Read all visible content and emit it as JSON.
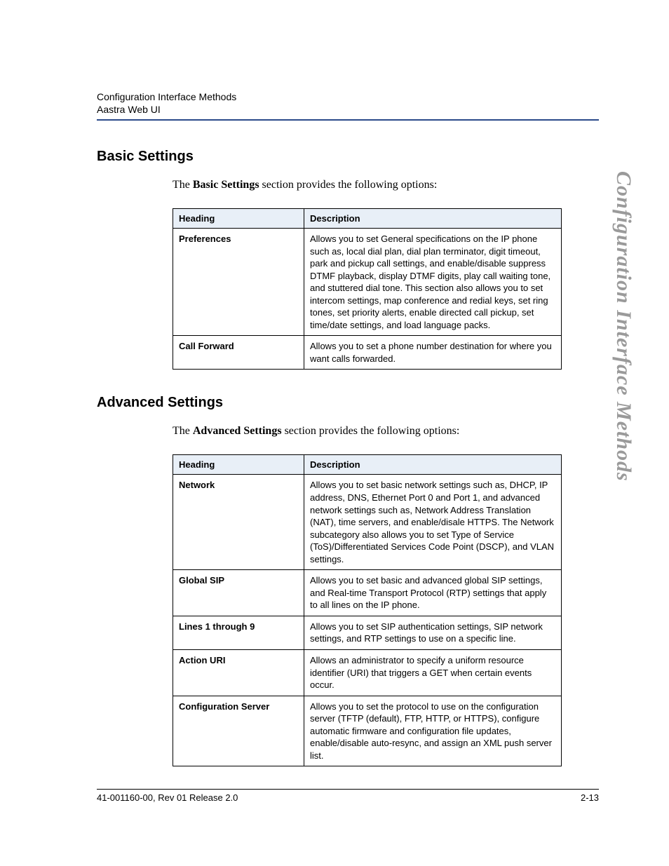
{
  "header": {
    "line1": "Configuration Interface Methods",
    "line2": "Aastra Web UI"
  },
  "side_title": "Configuration Interface Methods",
  "sections": {
    "basic": {
      "heading": "Basic Settings",
      "intro_prefix": "The ",
      "intro_bold": "Basic Settings",
      "intro_suffix": " section provides the following options:",
      "col_heading": "Heading",
      "col_description": "Description",
      "rows": [
        {
          "heading": "Preferences",
          "description": "Allows you to set General specifications on the IP phone such as, local dial plan, dial plan terminator, digit timeout, park and pickup call settings, and enable/disable suppress DTMF playback, display DTMF digits, play call waiting tone, and stuttered dial tone. This section also allows you to set intercom settings, map conference and redial keys, set ring tones, set priority alerts, enable directed call pickup, set time/date settings, and load language packs."
        },
        {
          "heading": "Call Forward",
          "description": "Allows you to set a phone number destination for where you want calls forwarded."
        }
      ]
    },
    "advanced": {
      "heading": "Advanced Settings",
      "intro_prefix": "The ",
      "intro_bold": "Advanced Settings",
      "intro_suffix": " section provides the following options:",
      "col_heading": "Heading",
      "col_description": "Description",
      "rows": [
        {
          "heading": "Network",
          "description": "Allows you to set basic network settings such as, DHCP, IP address, DNS, Ethernet Port 0 and Port 1, and advanced network settings such as, Network Address Translation (NAT), time servers, and enable/disale HTTPS. The Network subcategory also allows you to set Type of Service (ToS)/Differentiated Services Code Point (DSCP), and VLAN settings."
        },
        {
          "heading": "Global SIP",
          "description": "Allows you to set basic and advanced global SIP settings, and Real-time Transport Protocol (RTP) settings that apply to all lines on the IP phone."
        },
        {
          "heading": "Lines 1 through 9",
          "description": "Allows you to set SIP authentication settings, SIP network settings, and RTP settings to use on a specific line."
        },
        {
          "heading": "Action URI",
          "description": "Allows an administrator to specify a uniform resource identifier (URI) that triggers a GET when certain events occur."
        },
        {
          "heading": "Configuration Server",
          "description": "Allows you to set the protocol to use on the configuration server (TFTP (default), FTP, HTTP, or HTTPS), configure automatic firmware and configuration file updates, enable/disable auto-resync, and assign an XML push server list."
        }
      ]
    }
  },
  "footer": {
    "left": "41-001160-00, Rev 01  Release 2.0",
    "right": "2-13"
  }
}
